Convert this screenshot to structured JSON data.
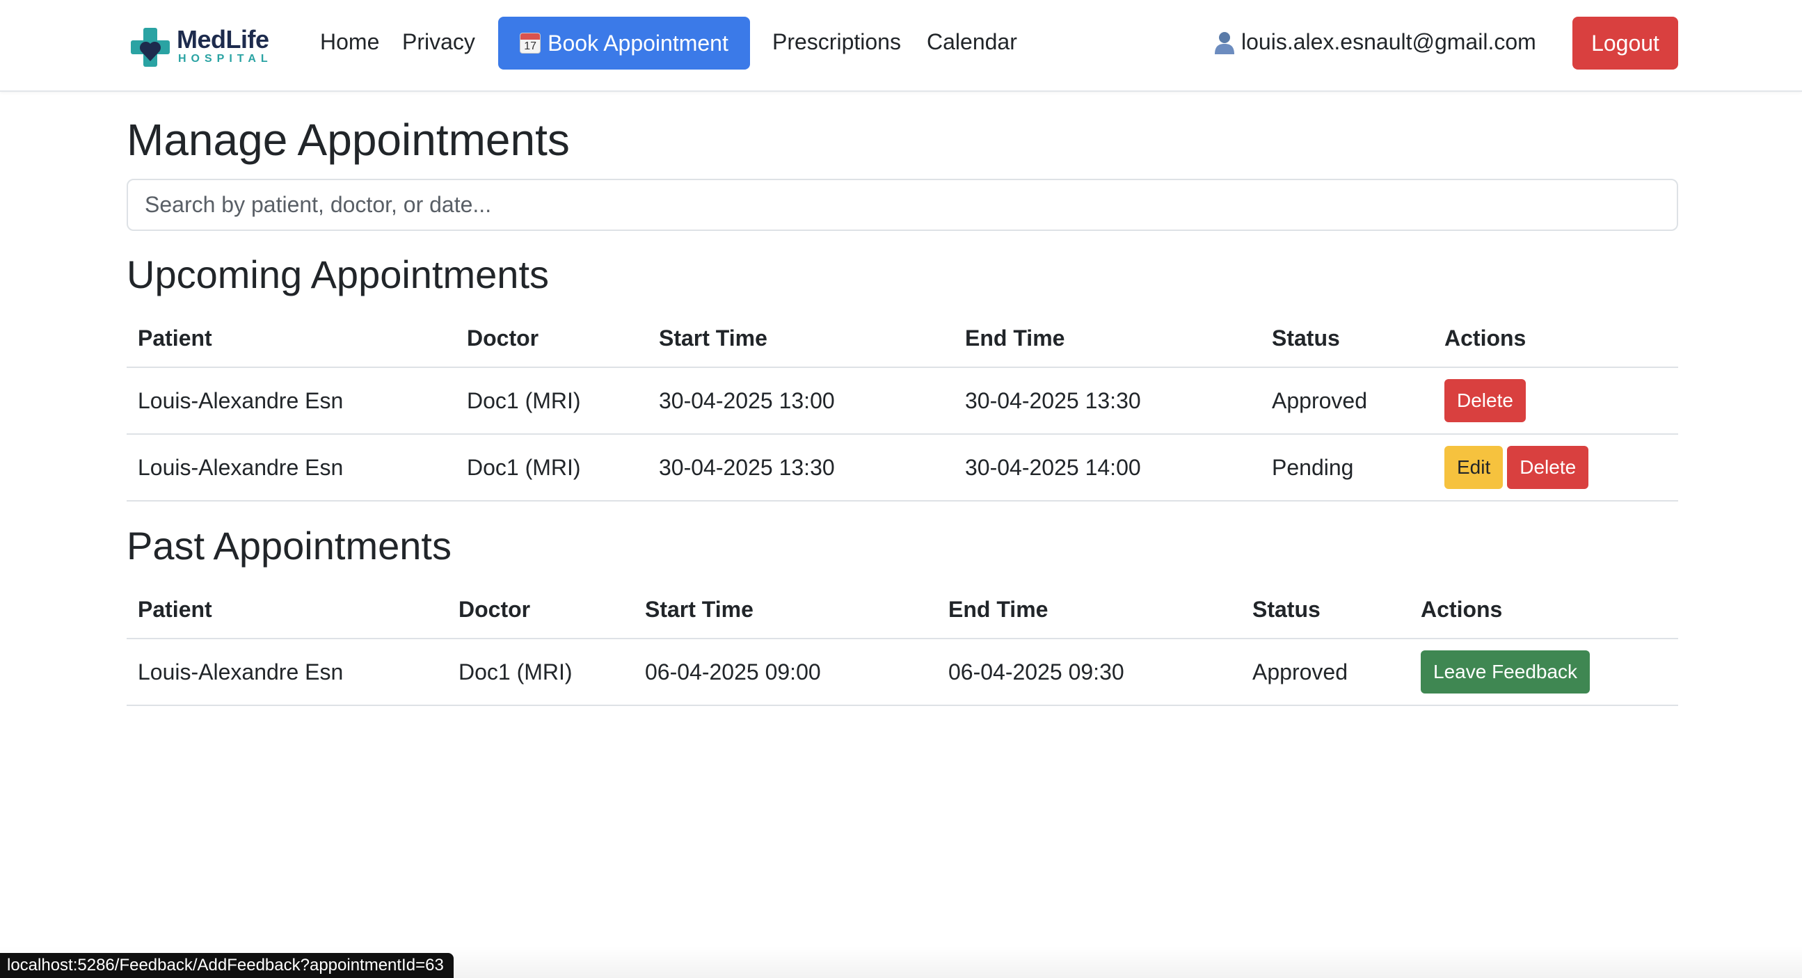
{
  "brand": {
    "name": "MedLife",
    "subtitle": "HOSPITAL"
  },
  "nav": {
    "home": "Home",
    "privacy": "Privacy",
    "book": "Book Appointment",
    "book_icon_day": "17",
    "prescriptions": "Prescriptions",
    "calendar": "Calendar"
  },
  "user": {
    "email": "louis.alex.esnault@gmail.com",
    "icon": "user-icon"
  },
  "logout_label": "Logout",
  "page_title": "Manage Appointments",
  "search": {
    "placeholder": "Search by patient, doctor, or date...",
    "value": ""
  },
  "upcoming": {
    "title": "Upcoming Appointments",
    "headers": [
      "Patient",
      "Doctor",
      "Start Time",
      "End Time",
      "Status",
      "Actions"
    ],
    "rows": [
      {
        "patient": "Louis-Alexandre Esn",
        "doctor": "Doc1 (MRI)",
        "start": "30-04-2025 13:00",
        "end": "30-04-2025 13:30",
        "status": "Approved",
        "delete": "Delete"
      },
      {
        "patient": "Louis-Alexandre Esn",
        "doctor": "Doc1 (MRI)",
        "start": "30-04-2025 13:30",
        "end": "30-04-2025 14:00",
        "status": "Pending",
        "edit": "Edit",
        "delete": "Delete"
      }
    ]
  },
  "past": {
    "title": "Past Appointments",
    "headers": [
      "Patient",
      "Doctor",
      "Start Time",
      "End Time",
      "Status",
      "Actions"
    ],
    "rows": [
      {
        "patient": "Louis-Alexandre Esn",
        "doctor": "Doc1 (MRI)",
        "start": "06-04-2025 09:00",
        "end": "06-04-2025 09:30",
        "status": "Approved",
        "feedback": "Leave Feedback"
      }
    ]
  },
  "status_bar": "localhost:5286/Feedback/AddFeedback?appointmentId=63",
  "colors": {
    "primary": "#3b7ae8",
    "danger": "#d9403f",
    "warning": "#f6c23e",
    "success": "#3f8752",
    "brand_navy": "#1d2b4d",
    "brand_teal": "#2aa3a3"
  }
}
